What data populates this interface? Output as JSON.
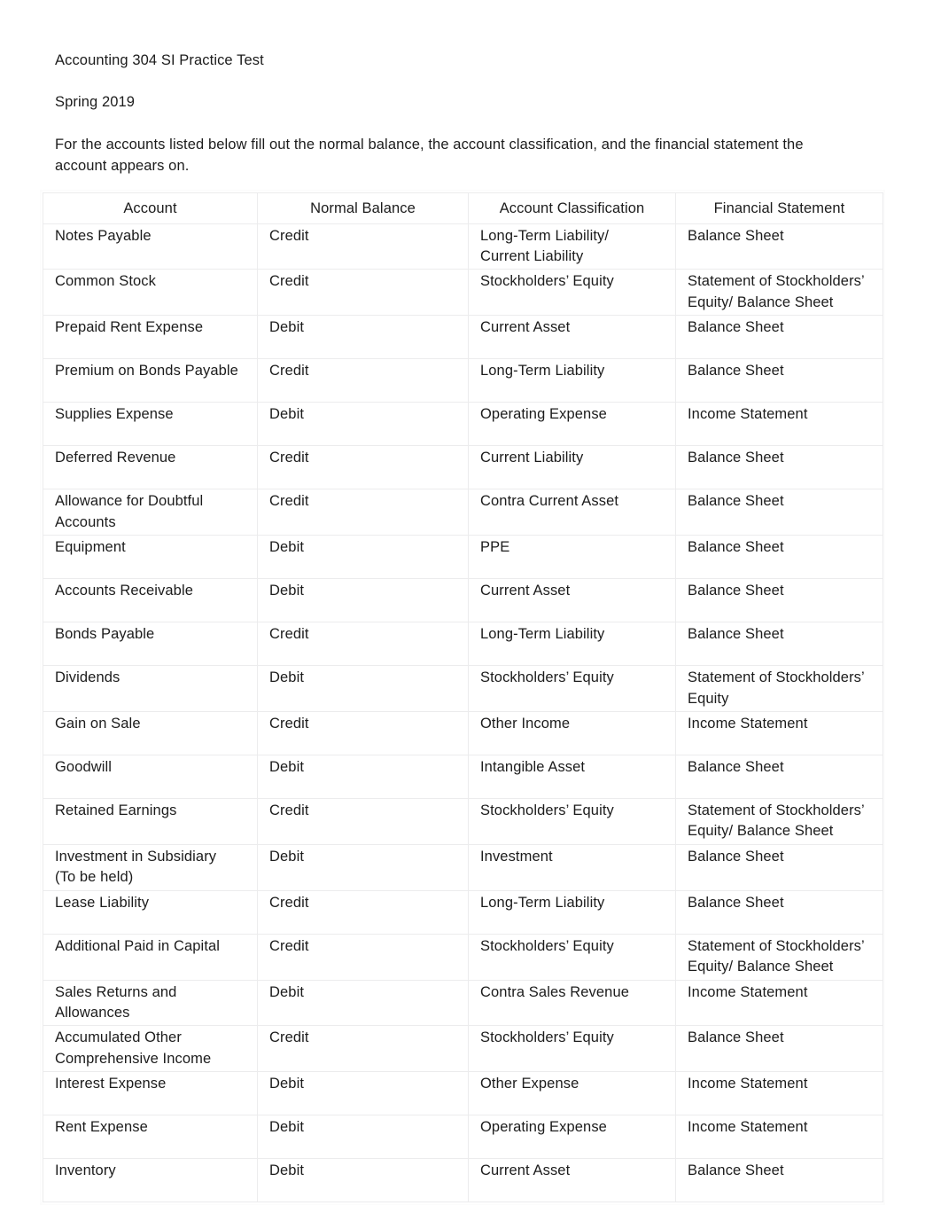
{
  "document": {
    "title": "Accounting 304 SI Practice Test",
    "term": "Spring 2019",
    "instructions": "For the accounts listed below fill out the normal balance, the account classification, and the financial statement the account appears on."
  },
  "table": {
    "headers": {
      "account": "Account",
      "normal_balance": "Normal Balance",
      "account_classification": "Account Classification",
      "financial_statement": "Financial Statement"
    },
    "rows": [
      {
        "account": "Notes Payable",
        "normal_balance": "Credit",
        "account_classification": "Long-Term Liability/\nCurrent Liability",
        "financial_statement": "Balance Sheet",
        "height": "tall"
      },
      {
        "account": "Common Stock",
        "normal_balance": "Credit",
        "account_classification": "Stockholders’ Equity",
        "financial_statement": "Statement of Stockholders’\nEquity/ Balance Sheet",
        "height": "short"
      },
      {
        "account": "Prepaid Rent Expense",
        "normal_balance": "Debit",
        "account_classification": "Current Asset",
        "financial_statement": "Balance Sheet",
        "height": "tall"
      },
      {
        "account": "Premium on Bonds Payable",
        "normal_balance": "Credit",
        "account_classification": "Long-Term Liability",
        "financial_statement": "Balance Sheet",
        "height": "tall"
      },
      {
        "account": "Supplies Expense",
        "normal_balance": "Debit",
        "account_classification": "Operating Expense",
        "financial_statement": "Income Statement",
        "height": "tall"
      },
      {
        "account": "Deferred Revenue",
        "normal_balance": "Credit",
        "account_classification": "Current Liability",
        "financial_statement": "Balance Sheet",
        "height": "tall"
      },
      {
        "account": "Allowance for Doubtful\nAccounts",
        "normal_balance": "Credit",
        "account_classification": "Contra Current Asset",
        "financial_statement": "Balance Sheet",
        "height": "short"
      },
      {
        "account": "Equipment",
        "normal_balance": "Debit",
        "account_classification": "PPE",
        "financial_statement": "Balance Sheet",
        "height": "tall"
      },
      {
        "account": "Accounts Receivable",
        "normal_balance": "Debit",
        "account_classification": "Current Asset",
        "financial_statement": "Balance Sheet",
        "height": "tall"
      },
      {
        "account": "Bonds Payable",
        "normal_balance": "Credit",
        "account_classification": "Long-Term Liability",
        "financial_statement": "Balance Sheet",
        "height": "tall"
      },
      {
        "account": "Dividends",
        "normal_balance": "Debit",
        "account_classification": "Stockholders’ Equity",
        "financial_statement": "Statement of Stockholders’\nEquity",
        "height": "short"
      },
      {
        "account": "Gain on Sale",
        "normal_balance": "Credit",
        "account_classification": "Other Income",
        "financial_statement": "Income Statement",
        "height": "tall"
      },
      {
        "account": "Goodwill",
        "normal_balance": "Debit",
        "account_classification": "Intangible Asset",
        "financial_statement": "Balance Sheet",
        "height": "tall"
      },
      {
        "account": "Retained Earnings",
        "normal_balance": "Credit",
        "account_classification": "Stockholders’ Equity",
        "financial_statement": "Statement of Stockholders’\nEquity/ Balance Sheet",
        "height": "short"
      },
      {
        "account": "Investment in Subsidiary\n(To be held)",
        "normal_balance": "Debit",
        "account_classification": "Investment",
        "financial_statement": "Balance Sheet",
        "height": "short"
      },
      {
        "account": "Lease Liability",
        "normal_balance": "Credit",
        "account_classification": "Long-Term Liability",
        "financial_statement": "Balance Sheet",
        "height": "tall"
      },
      {
        "account": "Additional Paid in Capital",
        "normal_balance": "Credit",
        "account_classification": "Stockholders’ Equity",
        "financial_statement": "Statement of Stockholders’\nEquity/ Balance Sheet",
        "height": "short"
      },
      {
        "account": "Sales Returns and\nAllowances",
        "normal_balance": "Debit",
        "account_classification": "Contra Sales Revenue",
        "financial_statement": "Income Statement",
        "height": "short"
      },
      {
        "account": "Accumulated Other\nComprehensive Income",
        "normal_balance": "Credit",
        "account_classification": "Stockholders’ Equity",
        "financial_statement": "Balance Sheet",
        "height": "short"
      },
      {
        "account": "Interest Expense",
        "normal_balance": "Debit",
        "account_classification": "Other Expense",
        "financial_statement": "Income Statement",
        "height": "tall"
      },
      {
        "account": "Rent Expense",
        "normal_balance": "Debit",
        "account_classification": "Operating Expense",
        "financial_statement": "Income Statement",
        "height": "tall"
      },
      {
        "account": "Inventory",
        "normal_balance": "Debit",
        "account_classification": "Current Asset",
        "financial_statement": "Balance Sheet",
        "height": "tall"
      }
    ]
  }
}
